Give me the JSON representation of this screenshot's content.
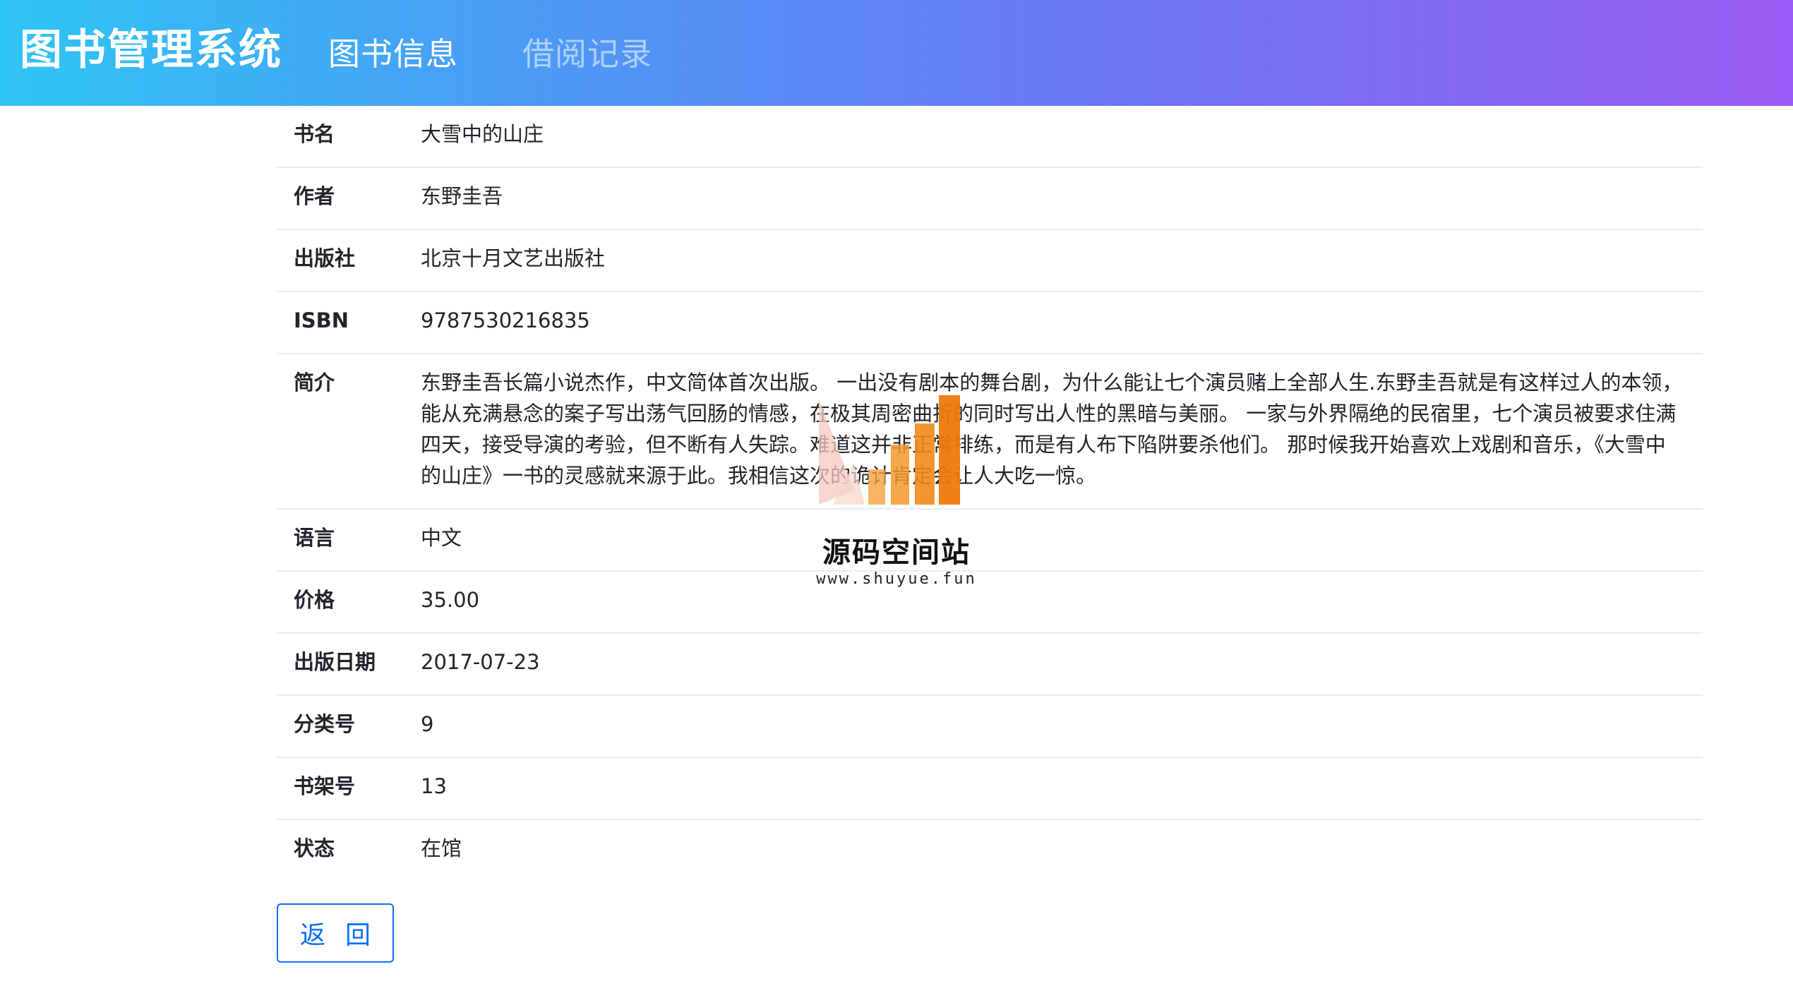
{
  "navbar": {
    "brand": "图书管理系统",
    "links": [
      {
        "label": "图书信息",
        "active": true
      },
      {
        "label": "借阅记录",
        "active": false
      }
    ],
    "gradient": [
      "#2ec4f4",
      "#9b5cf6"
    ]
  },
  "book": {
    "rows": [
      {
        "label": "书名",
        "value": "大雪中的山庄"
      },
      {
        "label": "作者",
        "value": "东野圭吾"
      },
      {
        "label": "出版社",
        "value": "北京十月文艺出版社"
      },
      {
        "label": "ISBN",
        "value": "9787530216835"
      },
      {
        "label": "简介",
        "value": "东野圭吾长篇小说杰作，中文简体首次出版。 一出没有剧本的舞台剧，为什么能让七个演员赌上全部人生.东野圭吾就是有这样过人的本领，能从充满悬念的案子写出荡气回肠的情感，在极其周密曲折的同时写出人性的黑暗与美丽。 一家与外界隔绝的民宿里，七个演员被要求住满四天，接受导演的考验，但不断有人失踪。难道这并非正常排练，而是有人布下陷阱要杀他们。 那时候我开始喜欢上戏剧和音乐，《大雪中的山庄》一书的灵感就来源于此。我相信这次的诡计肯定会让人大吃一惊。"
      },
      {
        "label": "语言",
        "value": "中文"
      },
      {
        "label": "价格",
        "value": "35.00"
      },
      {
        "label": "出版日期",
        "value": "2017-07-23"
      },
      {
        "label": "分类号",
        "value": "9"
      },
      {
        "label": "书架号",
        "value": "13"
      },
      {
        "label": "状态",
        "value": "在馆"
      }
    ]
  },
  "actions": {
    "back_label": "返回",
    "accent": "#0d6efd"
  },
  "watermark": {
    "title": "源码空间站",
    "url": "www.shuyue.fun"
  }
}
